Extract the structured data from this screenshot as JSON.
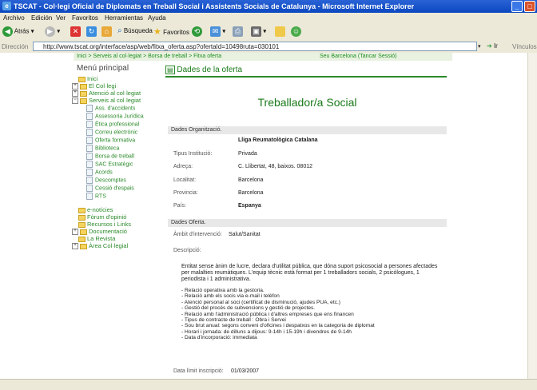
{
  "window": {
    "title": "TSCAT - Col·legi Oficial de Diplomats en Treball Social i Assistents Socials de Catalunya - Microsoft Internet Explorer"
  },
  "menubar": [
    "Archivo",
    "Edición",
    "Ver",
    "Favoritos",
    "Herramientas",
    "Ayuda"
  ],
  "toolbar": {
    "back_label": "Atrás",
    "search_label": "Búsqueda",
    "favorites_label": "Favoritos"
  },
  "address": {
    "label": "Dirección",
    "url": "http://www.tscat.org/interface/asp/web/fitxa_oferta.asp?ofertaId=10498ruta=030101",
    "go_label": "Ir",
    "links_label": "Vínculos"
  },
  "breadcrumb": {
    "path": "Inici > Serveis al col·legiat > Borsa de treball > Fitxa oferta",
    "session": "Seu Barcelona  (Tancar Sessió)"
  },
  "menu": {
    "title": "Menú principal",
    "top": [
      "Inici",
      "El Col·legi",
      "Atenció al col·legiat",
      "Serveis al col·legiat"
    ],
    "sub": [
      "Ass. d'accidents",
      "Assessoria Jurídica",
      "Ètica professional",
      "Correu electrònic",
      "Oferta formativa",
      "Biblioteca",
      "Borsa de treball",
      "SAC Estratègic",
      "Acords",
      "Descomptes",
      "Cessió d'espais",
      "RTS"
    ],
    "bottom": [
      "e-notícies",
      "Fòrum d'opinió",
      "Recursos i Links",
      "Documentació",
      "La Revista",
      "Àrea Col·legial"
    ]
  },
  "offer": {
    "section_title": "Dades de la oferta",
    "job_title": "Treballador/a Social",
    "org_band": "Dades Organització.",
    "org_name": "Lliga Reumatològica Catalana",
    "fields": [
      {
        "label": "Tipus Institució:",
        "value": "Privada"
      },
      {
        "label": "Adreça:",
        "value": "C. Llibertat, 48, baixos. 08012"
      },
      {
        "label": "Localitat:",
        "value": "Barcelona"
      },
      {
        "label": "Provincia:",
        "value": "Barcelona"
      },
      {
        "label": "País:",
        "value": "Espanya"
      }
    ],
    "offer_band": "Dades Oferta.",
    "ambit_label": "Àmbit d'intervenció:",
    "ambit_value": "Salut/Sanitat",
    "desc_label": "Descripció:",
    "desc_para": "Entitat sense ànim de lucre, declara d'utilitat pública, que dóna suport psicosocial a persones afectades per malalties reumàtiques. L'equip tècnic està format per 1 treballadors socials, 2 psicòlogues, 1 periodista i 1 administrativa.",
    "desc_list": [
      "- Relació operativa amb la gestoria.",
      "- Relació amb els socis via e-mail i telèfon",
      "- Atenció personal al soci (certificat de disminució, ajudes PUA, etc.)",
      "- Gestió del procés de subvencions y gestió de projectes.",
      "- Relació amb l'administració pública i d'altres empreses que ens financen",
      "- Tipus de contracte de treball : Obra i Servei",
      "- Sou brut anual: segons conveni d'oficines i despatxos en la categoria de diplomat",
      "- Horari i jornada: de dilluns a dijous: 9-14h i 15-19h i divendres de 9-14h",
      "- Data d'incorporació: immediata"
    ],
    "deadline_label": "Data límit inscripció:",
    "deadline_value": "01/03/2007"
  }
}
